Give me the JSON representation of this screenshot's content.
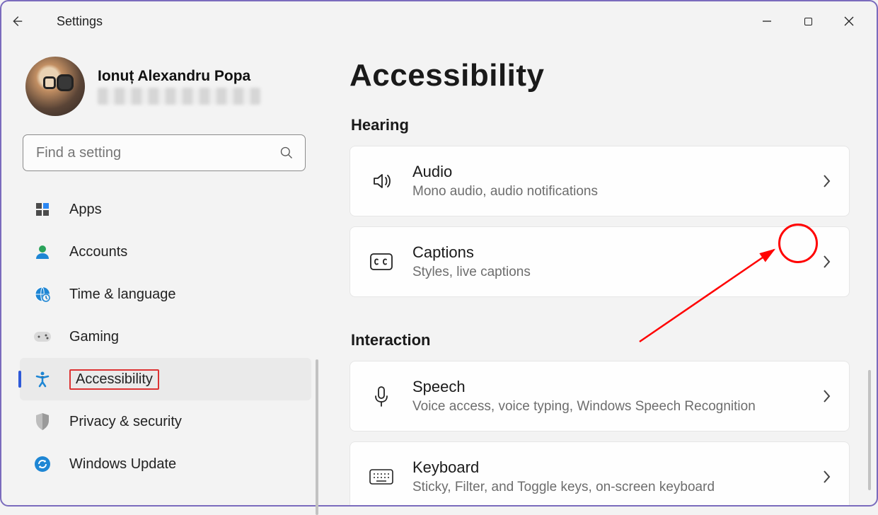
{
  "app_title": "Settings",
  "window_controls": {
    "minimize": "–",
    "maximize": "▢",
    "close": "✕"
  },
  "user": {
    "name": "Ionuț Alexandru Popa",
    "email_redacted": true
  },
  "search": {
    "placeholder": "Find a setting"
  },
  "sidebar": {
    "items": [
      {
        "icon": "apps-icon",
        "label": "Apps"
      },
      {
        "icon": "accounts-icon",
        "label": "Accounts"
      },
      {
        "icon": "time-language-icon",
        "label": "Time & language"
      },
      {
        "icon": "gaming-icon",
        "label": "Gaming"
      },
      {
        "icon": "accessibility-icon",
        "label": "Accessibility",
        "selected": true
      },
      {
        "icon": "privacy-icon",
        "label": "Privacy & security"
      },
      {
        "icon": "update-icon",
        "label": "Windows Update"
      }
    ]
  },
  "page": {
    "title": "Accessibility",
    "sections": [
      {
        "heading": "Hearing",
        "items": [
          {
            "icon": "audio-icon",
            "title": "Audio",
            "subtitle": "Mono audio, audio notifications"
          },
          {
            "icon": "captions-icon",
            "title": "Captions",
            "subtitle": "Styles, live captions",
            "highlighted": true
          }
        ]
      },
      {
        "heading": "Interaction",
        "items": [
          {
            "icon": "speech-icon",
            "title": "Speech",
            "subtitle": "Voice access, voice typing, Windows Speech Recognition"
          },
          {
            "icon": "keyboard-icon",
            "title": "Keyboard",
            "subtitle": "Sticky, Filter, and Toggle keys, on-screen keyboard"
          }
        ]
      }
    ]
  },
  "annotation": {
    "target": "captions-chevron"
  }
}
